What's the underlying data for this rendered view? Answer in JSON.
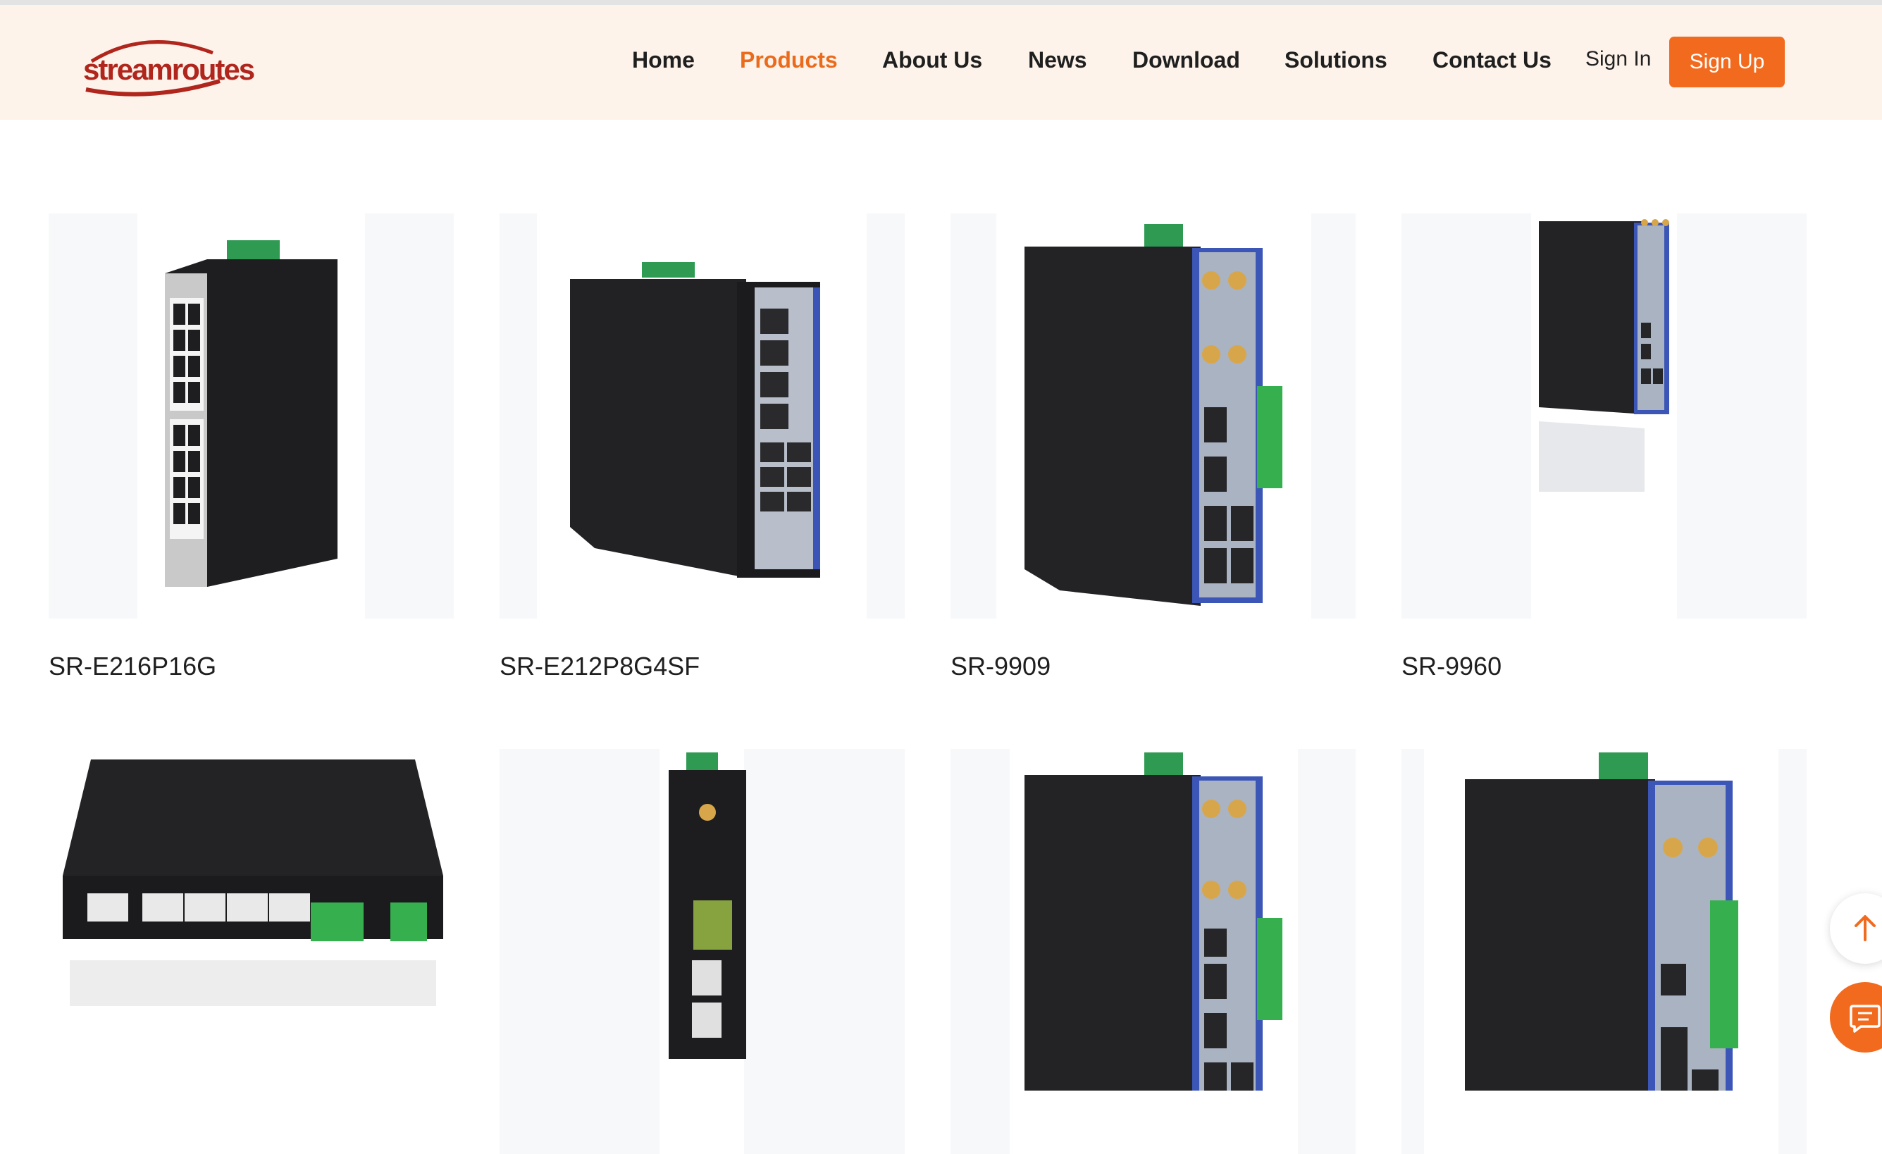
{
  "brand": {
    "name": "streamroutes",
    "logo_color": "#b0261d"
  },
  "nav": {
    "items": [
      {
        "label": "Home",
        "active": false
      },
      {
        "label": "Products",
        "active": true
      },
      {
        "label": "About Us",
        "active": false
      },
      {
        "label": "News",
        "active": false
      },
      {
        "label": "Download",
        "active": false
      },
      {
        "label": "Solutions",
        "active": false
      },
      {
        "label": "Contact Us",
        "active": false
      }
    ],
    "sign_in": "Sign In",
    "sign_up": "Sign Up",
    "accent_color": "#f26a1e"
  },
  "products": [
    {
      "name": "SR-E216P16G",
      "icon": "industrial-switch-16port"
    },
    {
      "name": "SR-E212P8G4SF",
      "icon": "industrial-switch-sfp"
    },
    {
      "name": "SR-9909",
      "icon": "industrial-router"
    },
    {
      "name": "SR-9960",
      "icon": "industrial-router-small"
    },
    {
      "name": "",
      "icon": "desktop-router"
    },
    {
      "name": "",
      "icon": "din-rail-router-slim"
    },
    {
      "name": "",
      "icon": "industrial-router"
    },
    {
      "name": "",
      "icon": "industrial-router-large"
    }
  ],
  "floating": {
    "scroll_top_icon": "arrow-up-icon",
    "chat_icon": "chat-icon"
  }
}
